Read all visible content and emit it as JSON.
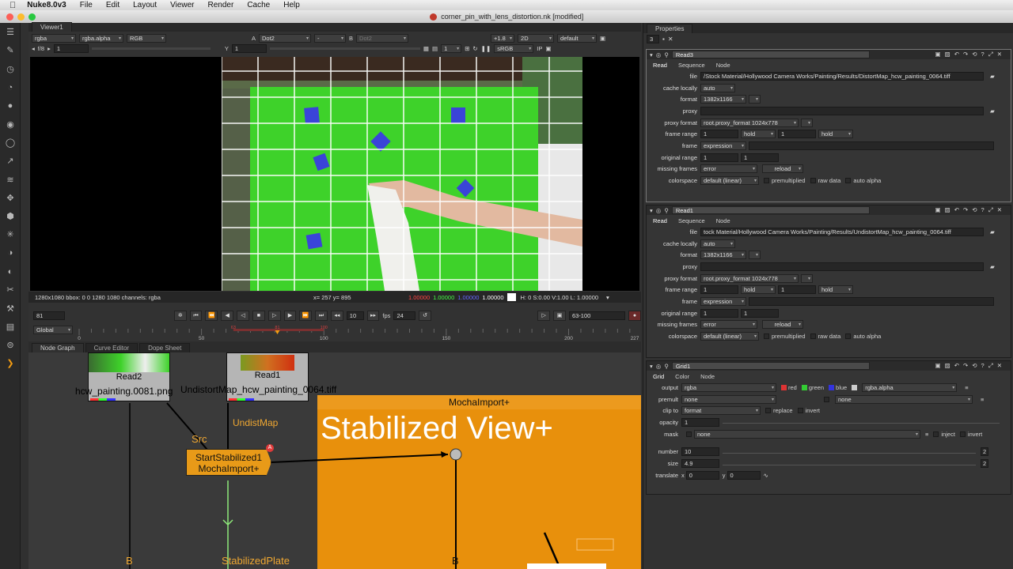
{
  "menubar": {
    "app_name": "Nuke8.0v3",
    "items": [
      "File",
      "Edit",
      "Layout",
      "Viewer",
      "Render",
      "Cache",
      "Help"
    ]
  },
  "window": {
    "title": "corner_pin_with_lens_distortion.nk [modified]"
  },
  "viewer": {
    "tab": "Viewer1",
    "channels": "rgba",
    "alpha_channel": "rgba.alpha",
    "display_channels": "RGB",
    "a_label": "A",
    "a_input": "Dot2",
    "wipe": "-",
    "b_label": "B",
    "b_input": "Dot2",
    "gain": "+1.8",
    "view_mode": "2D",
    "lut_default": "default",
    "proxy": "1",
    "colorspace": "sRGB",
    "fstop": "f/8",
    "gamma_value": "1",
    "y_label": "Y",
    "y_value": "1",
    "status_info": "1280x1080 bbox: 0 0 1280 1080 channels: rgba",
    "cursor": "x= 257 y= 895",
    "pixel_r": "1.00000",
    "pixel_g": "1.00000",
    "pixel_b": "1.00000",
    "pixel_a": "1.00000",
    "hsv": "H:  0 S:0.00 V:1.00  L: 1.00000",
    "frame": "81",
    "step": "10",
    "fps_label": "fps",
    "fps": "24",
    "range": "63-100",
    "global_label": "Global",
    "timeline_ticks": [
      "0",
      "50",
      "100",
      "150",
      "200",
      "227"
    ],
    "timeline_markers": [
      "63",
      "81",
      "100"
    ],
    "timeline": {
      "start": 0,
      "end": 227,
      "current": 81,
      "in": 63,
      "out": 100
    }
  },
  "nodegraph": {
    "tabs": [
      "Node Graph",
      "Curve Editor",
      "Dope Sheet"
    ],
    "read2": {
      "name": "Read2",
      "file": "hcw_painting.0081.png"
    },
    "read1": {
      "name": "Read1",
      "file": "UndistortMap_hcw_painting_0064.tiff"
    },
    "src_label": "Src",
    "undist_label": "UndistMap",
    "mocha_node": {
      "line1": "StartStabilized1",
      "line2": "MochaImport+"
    },
    "backdrop": {
      "title": "MochaImport+",
      "label": "Stabilized View+"
    },
    "b_label": "B",
    "stabplate_label": "StabilizedPlate",
    "b2_label": "B",
    "badge": "A"
  },
  "properties": {
    "title": "Properties",
    "max_panels": "3",
    "read3": {
      "name": "Read3",
      "tabs": [
        "Read",
        "Sequence",
        "Node"
      ],
      "file": "/Stock Material/Hollywood Camera Works/Painting/Results/DistortMap_hcw_painting_0064.tiff",
      "cache_locally": "auto",
      "format": "1382x1166",
      "proxy": "",
      "proxy_format": "root.proxy_format 1024x778",
      "frame_range_start": "1",
      "frame_range_start_mode": "hold",
      "frame_range_end": "1",
      "frame_range_end_mode": "hold",
      "frame": "expression",
      "original_range_start": "1",
      "original_range_end": "1",
      "missing_frames": "error",
      "reload": "reload",
      "colorspace": "default (linear)"
    },
    "read1": {
      "name": "Read1",
      "tabs": [
        "Read",
        "Sequence",
        "Node"
      ],
      "file": "tock Material/Hollywood Camera Works/Painting/Results/UndistortMap_hcw_painting_0064.tiff",
      "cache_locally": "auto",
      "format": "1382x1166",
      "proxy": "",
      "proxy_format": "root.proxy_format 1024x778",
      "frame_range_start": "1",
      "frame_range_start_mode": "hold",
      "frame_range_end": "1",
      "frame_range_end_mode": "hold",
      "frame": "expression",
      "original_range_start": "1",
      "original_range_end": "1",
      "missing_frames": "error",
      "reload": "reload",
      "colorspace": "default (linear)"
    },
    "labels": {
      "file": "file",
      "cache_locally": "cache locally",
      "format": "format",
      "proxy": "proxy",
      "proxy_format": "proxy format",
      "frame_range": "frame range",
      "frame": "frame",
      "original_range": "original range",
      "missing_frames": "missing frames",
      "colorspace": "colorspace",
      "premultiplied": "premultiplied",
      "raw_data": "raw data",
      "auto_alpha": "auto alpha"
    },
    "grid1": {
      "name": "Grid1",
      "tabs": [
        "Grid",
        "Color",
        "Node"
      ],
      "output_label": "output",
      "output": "rgba",
      "red": "red",
      "green": "green",
      "blue": "blue",
      "alpha_channel": "rgba.alpha",
      "premult_label": "premult",
      "premult": "none",
      "premult2": "none",
      "clip_to_label": "clip to",
      "clip_to": "format",
      "replace": "replace",
      "invert": "invert",
      "opacity_label": "opacity",
      "opacity": "1",
      "mask_label": "mask",
      "mask": "none",
      "inject": "inject",
      "mask_invert": "invert",
      "number_label": "number",
      "number": "10",
      "size_label": "size",
      "size": "4.9",
      "translate_label": "translate",
      "tx_label": "x",
      "tx": "0",
      "ty_label": "y",
      "ty": "0",
      "badge": "2"
    }
  },
  "colors": {
    "accent": "#f39c12",
    "backdrop": "#e8900c",
    "mocha_node": "#e89a18",
    "greenscreen": "#3ed22a",
    "marker": "#3a44d8"
  }
}
